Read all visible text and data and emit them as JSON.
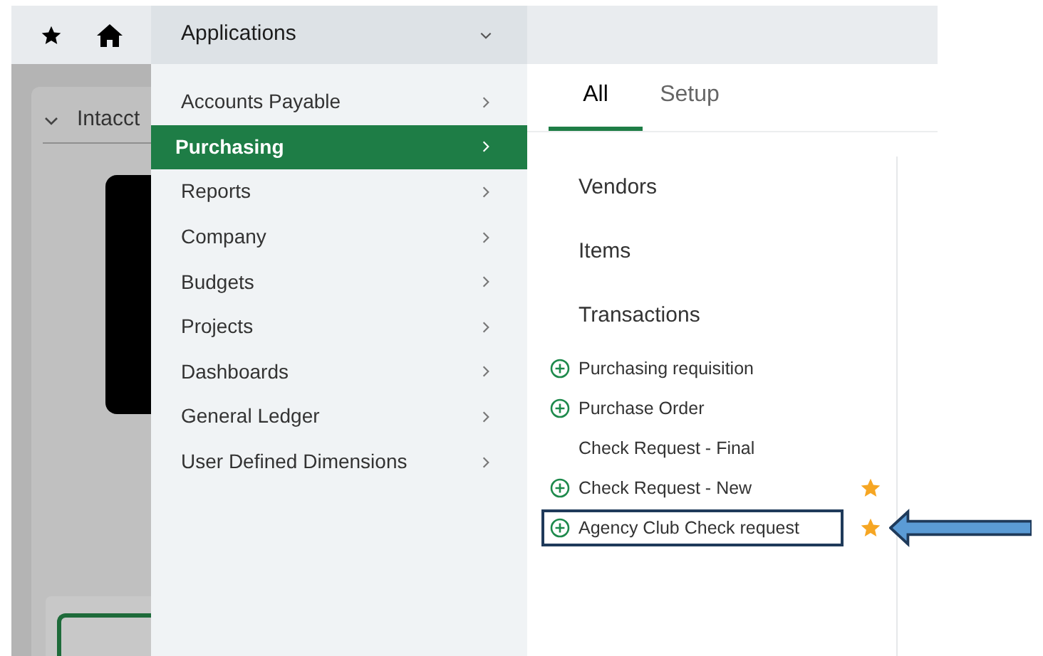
{
  "top_bar": {
    "menu_label": "Applications"
  },
  "background_card": {
    "title": "Intacct"
  },
  "applications": [
    {
      "label": "Accounts Payable",
      "selected": false
    },
    {
      "label": "Purchasing",
      "selected": true
    },
    {
      "label": "Reports",
      "selected": false
    },
    {
      "label": "Company",
      "selected": false
    },
    {
      "label": "Budgets",
      "selected": false
    },
    {
      "label": "Projects",
      "selected": false
    },
    {
      "label": "Dashboards",
      "selected": false
    },
    {
      "label": "General Ledger",
      "selected": false
    },
    {
      "label": "User Defined Dimensions",
      "selected": false
    }
  ],
  "tabs": [
    {
      "label": "All",
      "selected": true
    },
    {
      "label": "Setup",
      "selected": false
    }
  ],
  "sections": [
    {
      "title": "Vendors"
    },
    {
      "title": "Items"
    },
    {
      "title": "Transactions",
      "items": [
        {
          "label": "Purchasing requisition",
          "kind": "add",
          "starred": false,
          "highlighted": false
        },
        {
          "label": "Purchase Order",
          "kind": "add",
          "starred": false,
          "highlighted": false
        },
        {
          "label": "Check Request - Final",
          "kind": "plain",
          "starred": false,
          "highlighted": false
        },
        {
          "label": "Check Request - New",
          "kind": "add",
          "starred": true,
          "highlighted": false
        },
        {
          "label": "Agency Club Check request",
          "kind": "add",
          "starred": true,
          "highlighted": true
        }
      ]
    }
  ]
}
